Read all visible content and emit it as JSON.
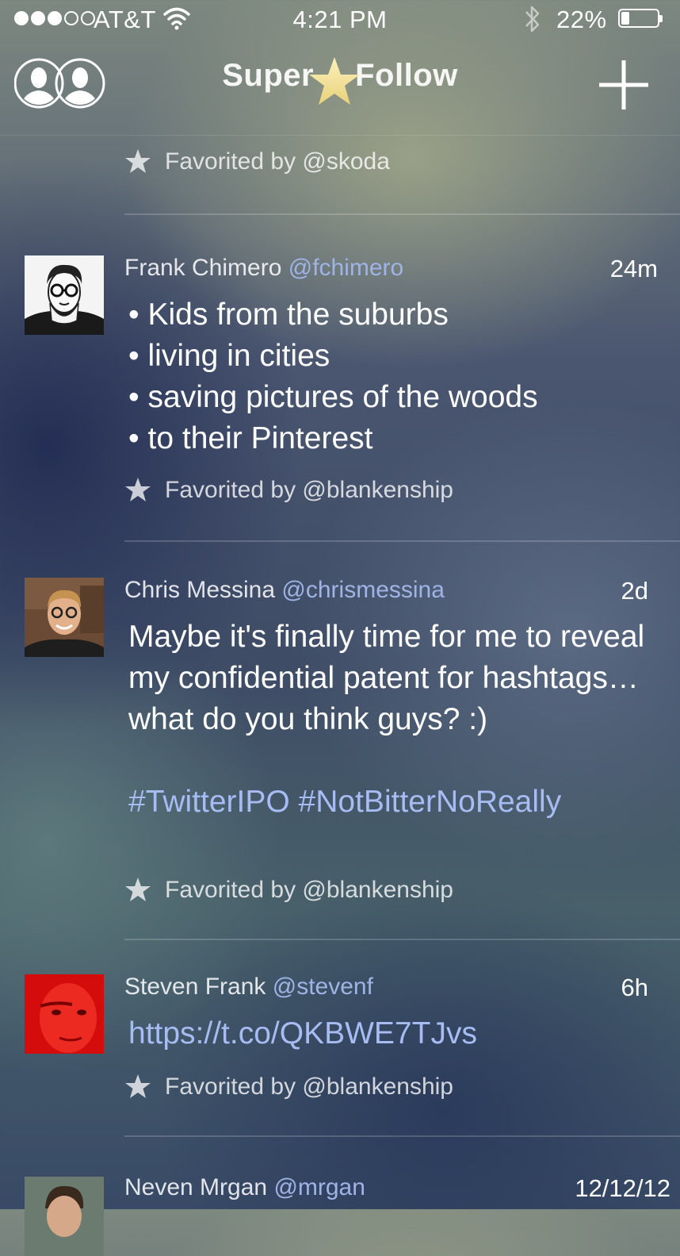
{
  "status_bar": {
    "carrier": "AT&T",
    "time": "4:21 PM",
    "battery_percent": "22%",
    "battery_level": 0.22,
    "signal_bars_on": 3,
    "signal_bars_total": 5
  },
  "nav": {
    "logo_left": "Super",
    "logo_right": "Follow",
    "accounts_icon": "two-people-icon",
    "add_icon": "plus-icon",
    "accent_star_color": "#f3e6a6"
  },
  "feed": {
    "top_favorited": "Favorited by @skoda",
    "tweets": [
      {
        "author": "Frank Chimero",
        "handle": "@fchimero",
        "time": "24m",
        "lines": [
          "Kids from the suburbs",
          "living in cities",
          "saving pictures of the woods",
          "to their Pinterest"
        ],
        "favorited": "Favorited by @blankenship"
      },
      {
        "author": "Chris Messina",
        "handle": "@chrismessina",
        "time": "2d",
        "text": "Maybe it's finally time for me to reveal my confidential patent for hashtags… what do you think guys? :)",
        "hashtags": "#TwitterIPO #NotBitterNoReally",
        "favorited": "Favorited by @blankenship"
      },
      {
        "author": "Steven Frank",
        "handle": "@stevenf",
        "time": "6h",
        "link": "https://t.co/QKBWE7TJvs",
        "favorited": "Favorited by @blankenship"
      },
      {
        "author": "Neven Mrgan",
        "handle": "@mrgan",
        "time": "12/12/12"
      }
    ]
  }
}
